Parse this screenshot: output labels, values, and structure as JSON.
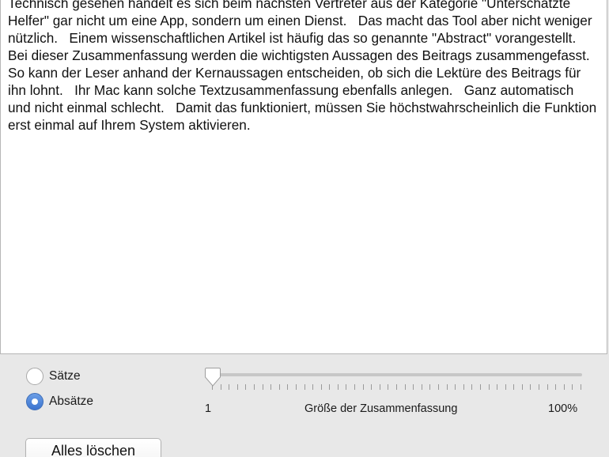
{
  "summary_text": "Technisch gesehen handelt es sich beim nächsten Vertreter aus der Kategorie \"Unterschätzte Helfer\" gar nicht um eine App, sondern um einen Dienst.   Das macht das Tool aber nicht weniger nützlich.   Einem wissenschaftlichen Artikel ist häufig das so genannte \"Abstract\" vorangestellt.   Bei dieser Zusammenfassung werden die wichtigsten Aussagen des Beitrags zusammengefasst.   So kann der Leser anhand der Kernaussagen entscheiden, ob sich die Lektüre des Beitrags für ihn lohnt.   Ihr Mac kann solche Textzusammenfassung ebenfalls anlegen.   Ganz automatisch und nicht einmal schlecht.   Damit das funktioniert, müssen Sie höchstwahrscheinlich die Funktion erst einmal auf Ihrem System aktivieren.",
  "mode_options": {
    "sentences_label": "Sätze",
    "paragraphs_label": "Absätze",
    "selected": "paragraphs"
  },
  "summary_slider": {
    "min_label": "1",
    "title": "Größe der Zusammenfassung",
    "max_label": "100%",
    "value_fraction": 0.0,
    "tick_count": 45
  },
  "clear_button_label": "Alles löschen",
  "colors": {
    "accent": "#3c74cf",
    "track": "#c7c7c7",
    "background": "#e8e8e8"
  }
}
